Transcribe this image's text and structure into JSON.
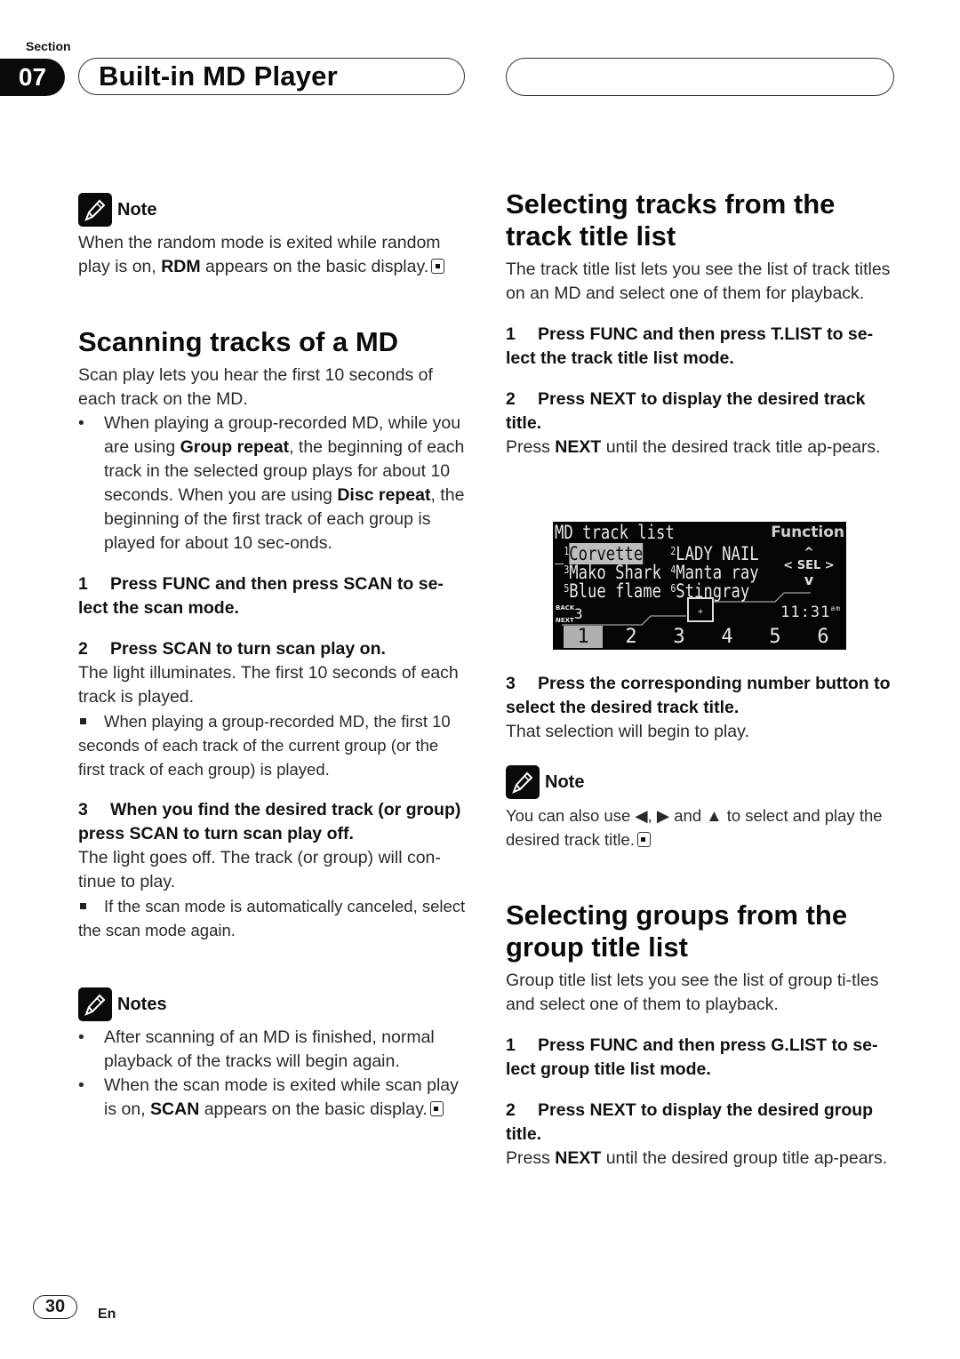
{
  "header": {
    "section_label": "Section",
    "section_number": "07",
    "title": "Built-in MD Player"
  },
  "left": {
    "note1": {
      "title": "Note",
      "text_pre": "When the random mode is exited while random play is on, ",
      "bold": "RDM",
      "text_post": " appears on the basic display."
    },
    "scan": {
      "heading": "Scanning tracks of a MD",
      "intro": "Scan play lets you hear the first 10 seconds of each track on the MD.",
      "bullet": {
        "p1": "When playing a group-recorded MD, while you are using ",
        "b1": "Group repeat",
        "p2": ", the beginning of each track in the selected group plays for about 10 seconds. When you are using ",
        "b2": "Disc repeat",
        "p3": ", the beginning of the first track of each group is played for about 10 sec-onds."
      },
      "step1": {
        "num": "1",
        "text": "Press FUNC and then press SCAN to se-lect the scan mode."
      },
      "step2": {
        "num": "2",
        "text": "Press SCAN to turn scan play on.",
        "body": "The light illuminates. The first 10 seconds of each track is played.",
        "sub": "When playing a group-recorded MD, the first 10 seconds of each track of the current group (or the first track of each group) is played."
      },
      "step3": {
        "num": "3",
        "text": "When you find the desired track (or group) press SCAN to turn scan play off.",
        "body": "The light goes off. The track (or group) will con-tinue to play.",
        "sub": "If the scan mode is automatically canceled, select the scan mode again."
      }
    },
    "notes": {
      "title": "Notes",
      "item1": "After scanning of an MD is finished, normal playback of the tracks will begin again.",
      "item2_pre": "When the scan mode is exited while scan play is on, ",
      "item2_bold": "SCAN",
      "item2_post": " appears on the basic display."
    }
  },
  "right": {
    "track": {
      "heading": "Selecting tracks from the track title list",
      "intro": "The track title list lets you see the list of track titles on an MD and select one of them for playback.",
      "step1": {
        "num": "1",
        "text": "Press FUNC and then press T.LIST to se-lect the track title list mode."
      },
      "step2": {
        "num": "2",
        "text": "Press NEXT to display the desired track title.",
        "body_pre": "Press ",
        "body_bold": "NEXT",
        "body_post": " until the desired track title ap-pears."
      },
      "step3": {
        "num": "3",
        "text": "Press the corresponding number button to select the desired track title.",
        "body": "That selection will begin to play."
      }
    },
    "lcd": {
      "title": "MD track list",
      "function_label": "Function",
      "sel_label": "SEL",
      "tracks": [
        {
          "num": "1",
          "name": "Corvette",
          "selected": true
        },
        {
          "num": "2",
          "name": "LADY NAIL",
          "selected": false
        },
        {
          "num": "3",
          "name": "Mako Shark",
          "selected": false
        },
        {
          "num": "4",
          "name": "Manta ray",
          "selected": false
        },
        {
          "num": "5",
          "name": "Blue flame",
          "selected": false
        },
        {
          "num": "6",
          "name": "Stingray",
          "selected": false
        }
      ],
      "back_label": "BACK",
      "next_label": "NEXT",
      "page": "3",
      "clock": "11:31",
      "clock_suffix": "am",
      "buttons": [
        "1",
        "2",
        "3",
        "4",
        "5",
        "6"
      ],
      "active_button": "1"
    },
    "note2": {
      "title": "Note",
      "text": "You can also use ◀, ▶ and ▲ to select and play the desired track title."
    },
    "group": {
      "heading": "Selecting groups from the group title list",
      "intro": "Group title list lets you see the list of group ti-tles and select one of them to playback.",
      "step1": {
        "num": "1",
        "text": "Press FUNC and then press G.LIST to se-lect group title list mode."
      },
      "step2": {
        "num": "2",
        "text": "Press NEXT to display the desired group title.",
        "body_pre": "Press ",
        "body_bold": "NEXT",
        "body_post": " until the desired group title ap-pears."
      }
    }
  },
  "footer": {
    "page_number": "30",
    "language": "En"
  }
}
